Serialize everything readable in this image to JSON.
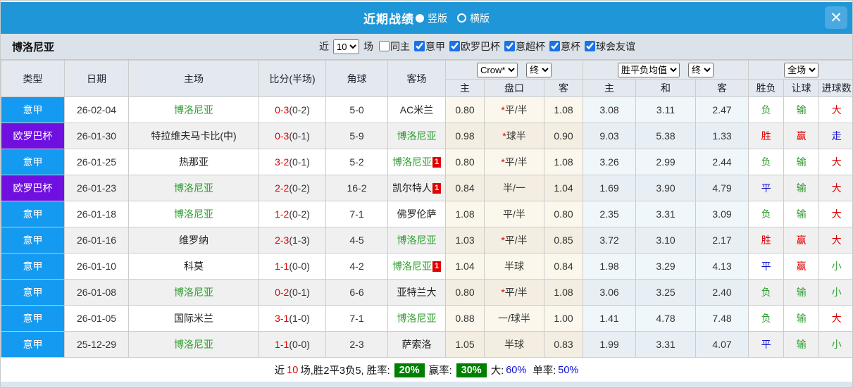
{
  "titlebar": {
    "title": "近期战绩",
    "radio_vertical": "竖版",
    "radio_horizontal": "横版",
    "close": "✕"
  },
  "filter": {
    "team": "博洛尼亚",
    "near_label": "近",
    "match_count": "10",
    "games_label": "场",
    "checkboxes": [
      {
        "label": "同主",
        "checked": false
      },
      {
        "label": "意甲",
        "checked": true
      },
      {
        "label": "欧罗巴杯",
        "checked": true
      },
      {
        "label": "意超杯",
        "checked": true
      },
      {
        "label": "意杯",
        "checked": true
      },
      {
        "label": "球会友谊",
        "checked": true
      }
    ]
  },
  "table": {
    "headers_left": [
      "类型",
      "日期",
      "主场",
      "比分(半场)",
      "角球",
      "客场"
    ],
    "selects": [
      "Crow*",
      "终",
      "胜平负均值",
      "终",
      "全场"
    ],
    "headers_sub": [
      "主",
      "盘口",
      "客",
      "主",
      "和",
      "客",
      "胜负",
      "让球",
      "进球数"
    ],
    "rows": [
      {
        "league": "意甲",
        "league_color": "blue",
        "date": "26-02-04",
        "home": "博洛尼亚",
        "home_team": true,
        "score": "0-3",
        "half": "(0-2)",
        "corner": "5-0",
        "away": "AC米兰",
        "away_team": false,
        "away_badge": "",
        "hcp_home": "0.80",
        "line": "*平/半",
        "hcp_away": "1.08",
        "avg_home": "3.08",
        "avg_draw": "3.11",
        "avg_away": "2.47",
        "outcome": "负",
        "outcome_color": "green",
        "handicap": "输",
        "handicap_color": "green",
        "goals": "大",
        "goals_color": "red"
      },
      {
        "league": "欧罗巴杯",
        "league_color": "purple",
        "date": "26-01-30",
        "home": "特拉维夫马卡比(中)",
        "home_team": false,
        "score": "0-3",
        "half": "(0-1)",
        "corner": "5-9",
        "away": "博洛尼亚",
        "away_team": true,
        "away_badge": "",
        "hcp_home": "0.98",
        "line": "*球半",
        "hcp_away": "0.90",
        "avg_home": "9.03",
        "avg_draw": "5.38",
        "avg_away": "1.33",
        "outcome": "胜",
        "outcome_color": "red",
        "handicap": "赢",
        "handicap_color": "red",
        "goals": "走",
        "goals_color": "blue"
      },
      {
        "league": "意甲",
        "league_color": "blue",
        "date": "26-01-25",
        "home": "热那亚",
        "home_team": false,
        "score": "3-2",
        "half": "(0-1)",
        "corner": "5-2",
        "away": "博洛尼亚",
        "away_team": true,
        "away_badge": "1",
        "hcp_home": "0.80",
        "line": "*平/半",
        "hcp_away": "1.08",
        "avg_home": "3.26",
        "avg_draw": "2.99",
        "avg_away": "2.44",
        "outcome": "负",
        "outcome_color": "green",
        "handicap": "输",
        "handicap_color": "green",
        "goals": "大",
        "goals_color": "red"
      },
      {
        "league": "欧罗巴杯",
        "league_color": "purple",
        "date": "26-01-23",
        "home": "博洛尼亚",
        "home_team": true,
        "score": "2-2",
        "half": "(0-2)",
        "corner": "16-2",
        "away": "凯尔特人",
        "away_team": false,
        "away_badge": "1",
        "hcp_home": "0.84",
        "line": "半/一",
        "hcp_away": "1.04",
        "avg_home": "1.69",
        "avg_draw": "3.90",
        "avg_away": "4.79",
        "outcome": "平",
        "outcome_color": "blue",
        "handicap": "输",
        "handicap_color": "green",
        "goals": "大",
        "goals_color": "red"
      },
      {
        "league": "意甲",
        "league_color": "blue",
        "date": "26-01-18",
        "home": "博洛尼亚",
        "home_team": true,
        "score": "1-2",
        "half": "(0-2)",
        "corner": "7-1",
        "away": "佛罗伦萨",
        "away_team": false,
        "away_badge": "",
        "hcp_home": "1.08",
        "line": "平/半",
        "hcp_away": "0.80",
        "avg_home": "2.35",
        "avg_draw": "3.31",
        "avg_away": "3.09",
        "outcome": "负",
        "outcome_color": "green",
        "handicap": "输",
        "handicap_color": "green",
        "goals": "大",
        "goals_color": "red"
      },
      {
        "league": "意甲",
        "league_color": "blue",
        "date": "26-01-16",
        "home": "维罗纳",
        "home_team": false,
        "score": "2-3",
        "half": "(1-3)",
        "corner": "4-5",
        "away": "博洛尼亚",
        "away_team": true,
        "away_badge": "",
        "hcp_home": "1.03",
        "line": "*平/半",
        "hcp_away": "0.85",
        "avg_home": "3.72",
        "avg_draw": "3.10",
        "avg_away": "2.17",
        "outcome": "胜",
        "outcome_color": "red",
        "handicap": "赢",
        "handicap_color": "red",
        "goals": "大",
        "goals_color": "red"
      },
      {
        "league": "意甲",
        "league_color": "blue",
        "date": "26-01-10",
        "home": "科莫",
        "home_team": false,
        "score": "1-1",
        "half": "(0-0)",
        "corner": "4-2",
        "away": "博洛尼亚",
        "away_team": true,
        "away_badge": "1",
        "hcp_home": "1.04",
        "line": "半球",
        "hcp_away": "0.84",
        "avg_home": "1.98",
        "avg_draw": "3.29",
        "avg_away": "4.13",
        "outcome": "平",
        "outcome_color": "blue",
        "handicap": "赢",
        "handicap_color": "red",
        "goals": "小",
        "goals_color": "green"
      },
      {
        "league": "意甲",
        "league_color": "blue",
        "date": "26-01-08",
        "home": "博洛尼亚",
        "home_team": true,
        "score": "0-2",
        "half": "(0-1)",
        "corner": "6-6",
        "away": "亚特兰大",
        "away_team": false,
        "away_badge": "",
        "hcp_home": "0.80",
        "line": "*平/半",
        "hcp_away": "1.08",
        "avg_home": "3.06",
        "avg_draw": "3.25",
        "avg_away": "2.40",
        "outcome": "负",
        "outcome_color": "green",
        "handicap": "输",
        "handicap_color": "green",
        "goals": "小",
        "goals_color": "green"
      },
      {
        "league": "意甲",
        "league_color": "blue",
        "date": "26-01-05",
        "home": "国际米兰",
        "home_team": false,
        "score": "3-1",
        "half": "(1-0)",
        "corner": "7-1",
        "away": "博洛尼亚",
        "away_team": true,
        "away_badge": "",
        "hcp_home": "0.88",
        "line": "一/球半",
        "hcp_away": "1.00",
        "avg_home": "1.41",
        "avg_draw": "4.78",
        "avg_away": "7.48",
        "outcome": "负",
        "outcome_color": "green",
        "handicap": "输",
        "handicap_color": "green",
        "goals": "大",
        "goals_color": "red"
      },
      {
        "league": "意甲",
        "league_color": "blue",
        "date": "25-12-29",
        "home": "博洛尼亚",
        "home_team": true,
        "score": "1-1",
        "half": "(0-0)",
        "corner": "2-3",
        "away": "萨索洛",
        "away_team": false,
        "away_badge": "",
        "hcp_home": "1.05",
        "line": "半球",
        "hcp_away": "0.83",
        "avg_home": "1.99",
        "avg_draw": "3.31",
        "avg_away": "4.07",
        "outcome": "平",
        "outcome_color": "blue",
        "handicap": "输",
        "handicap_color": "green",
        "goals": "小",
        "goals_color": "green"
      }
    ]
  },
  "footer": {
    "prefix": "近",
    "count": "10",
    "summary": "场,胜2平3负5, 胜率:",
    "win_rate": "20%",
    "profit_label": "赢率:",
    "profit_rate": "30%",
    "big_label": "大:",
    "big_value": "60%",
    "single_label": "单率:",
    "single_value": "50%"
  },
  "colors": {
    "titlebar_blue": "#1e96d7",
    "league_blue": "#149af0",
    "league_purple": "#6f10e0",
    "win_red": "#dd0000",
    "loss_green": "#2f9e2f",
    "draw_blue": "#1414cc",
    "team_green": "#2f9e2f",
    "score_red": "#e00000",
    "rate_badge_green": "#008000"
  }
}
